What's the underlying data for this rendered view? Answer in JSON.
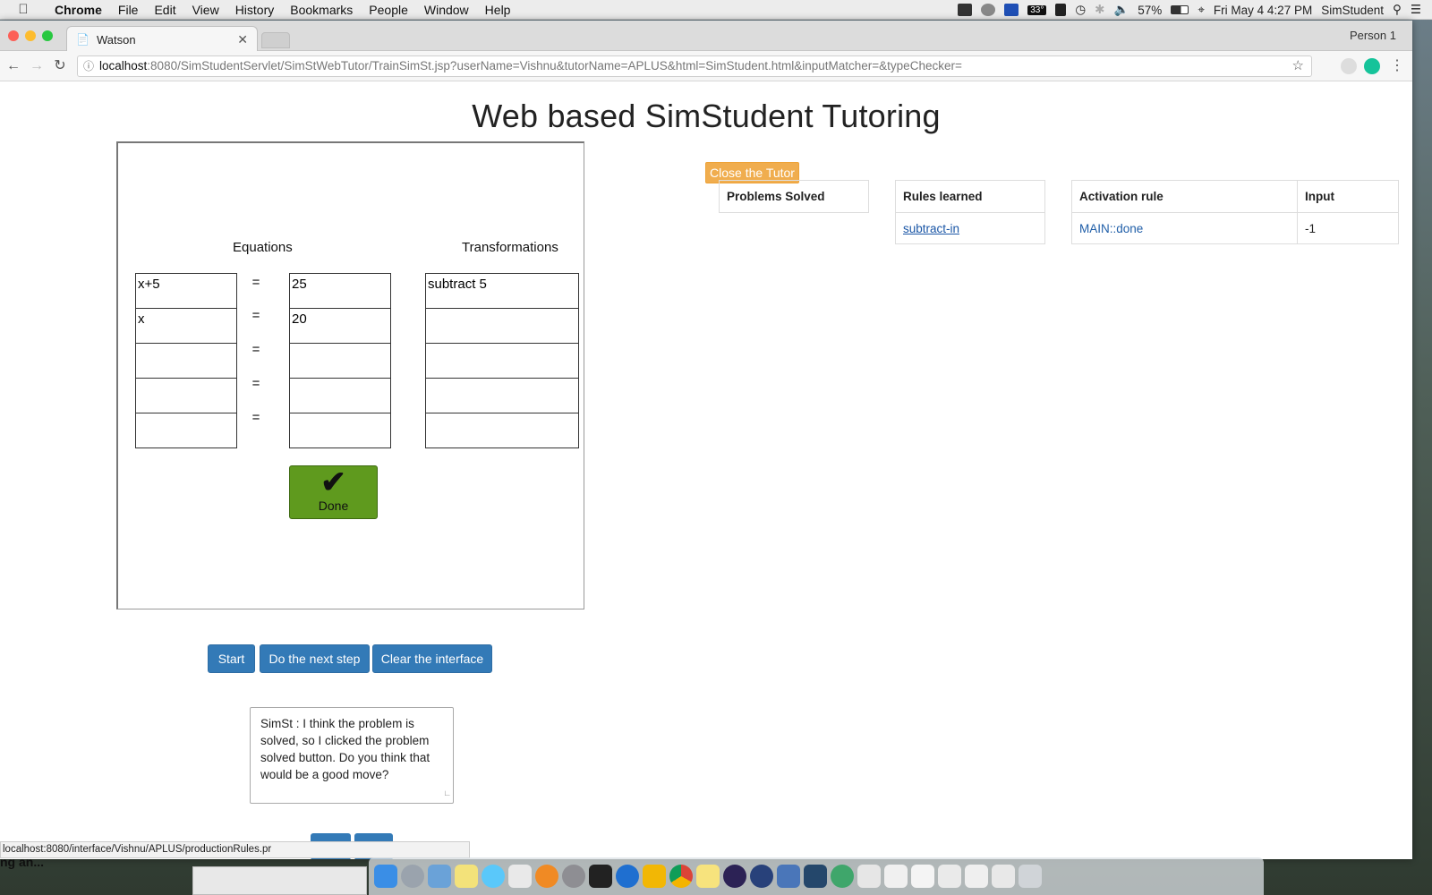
{
  "menubar": {
    "app": "Chrome",
    "items": [
      "File",
      "Edit",
      "View",
      "History",
      "Bookmarks",
      "People",
      "Window",
      "Help"
    ],
    "battery": "57%",
    "datetime": "Fri May 4  4:27 PM",
    "user": "SimStudent",
    "temp_badge": "33°"
  },
  "browser": {
    "tab_title": "Watson",
    "person": "Person 1",
    "url_host": "localhost",
    "url_rest": ":8080/SimStudentServlet/SimStWebTutor/TrainSimSt.jsp?userName=Vishnu&tutorName=APLUS&html=SimStudent.html&inputMatcher=&typeChecker=",
    "status_url": "localhost:8080/interface/Vishnu/APLUS/productionRules.pr"
  },
  "page": {
    "title": "Web based SimStudent Tutoring",
    "close_tutor_label": "Close the Tutor",
    "equations_header": "Equations",
    "transformations_header": "Transformations",
    "rows": [
      {
        "left": "x+5",
        "right": "25",
        "transformation": "subtract 5"
      },
      {
        "left": "x",
        "right": "20",
        "transformation": ""
      },
      {
        "left": "",
        "right": "",
        "transformation": ""
      },
      {
        "left": "",
        "right": "",
        "transformation": ""
      },
      {
        "left": "",
        "right": "",
        "transformation": ""
      }
    ],
    "equals_sign": "=",
    "done_check": "✔",
    "done_label": "Done",
    "buttons": {
      "start": "Start",
      "next_step": "Do the next step",
      "clear": "Clear the interface"
    },
    "message": "SimSt : I think the problem is solved, so I clicked the problem solved button. Do you think that would be a good move?",
    "problems_table": {
      "header": "Problems Solved"
    },
    "rules_table": {
      "header": "Rules learned",
      "rows": [
        "subtract-in"
      ]
    },
    "activation_table": {
      "headers": [
        "Activation rule",
        "Input"
      ],
      "rows": [
        {
          "rule": "MAIN::done",
          "input": "-1"
        }
      ]
    }
  },
  "background_text": "ng an..."
}
